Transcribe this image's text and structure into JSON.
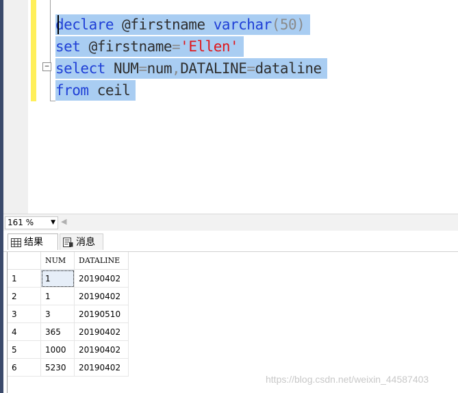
{
  "editor": {
    "lines": [
      [
        {
          "t": "declare",
          "c": "kw"
        },
        {
          "t": " @firstname ",
          "c": "tx"
        },
        {
          "t": "varchar",
          "c": "kw"
        },
        {
          "t": "(50)",
          "c": "op"
        }
      ],
      [
        {
          "t": "set",
          "c": "kw"
        },
        {
          "t": " @firstname",
          "c": "tx"
        },
        {
          "t": "=",
          "c": "op"
        },
        {
          "t": "'Ellen'",
          "c": "str"
        }
      ],
      [
        {
          "t": "select",
          "c": "kw"
        },
        {
          "t": " NUM",
          "c": "tx"
        },
        {
          "t": "=",
          "c": "op"
        },
        {
          "t": "num",
          "c": "tx"
        },
        {
          "t": ",",
          "c": "op"
        },
        {
          "t": "DATALINE",
          "c": "tx"
        },
        {
          "t": "=",
          "c": "op"
        },
        {
          "t": "dataline",
          "c": "tx"
        }
      ],
      [
        {
          "t": "from",
          "c": "kw"
        },
        {
          "t": " ceil",
          "c": "tx"
        }
      ]
    ],
    "fold_glyph": "−"
  },
  "zoom": {
    "value": "161 %",
    "dropdown_glyph": "▼",
    "scroll_left_glyph": "◀"
  },
  "tabs": [
    {
      "label": "结果",
      "icon": "grid-icon",
      "active": true
    },
    {
      "label": "消息",
      "icon": "messages-icon",
      "active": false
    }
  ],
  "grid": {
    "columns": [
      "",
      "NUM",
      "DATALINE"
    ],
    "rows": [
      [
        "1",
        "1",
        "20190402"
      ],
      [
        "2",
        "1",
        "20190402"
      ],
      [
        "3",
        "3",
        "20190510"
      ],
      [
        "4",
        "365",
        "20190402"
      ],
      [
        "5",
        "1000",
        "20190402"
      ],
      [
        "6",
        "5230",
        "20190402"
      ]
    ]
  },
  "watermark": "https://blog.csdn.net/weixin_44587403",
  "colors": {
    "keyword": "#1f3fd6",
    "string": "#e0161a",
    "selection": "#a9cdf2",
    "change_bar": "#ffef5a"
  }
}
